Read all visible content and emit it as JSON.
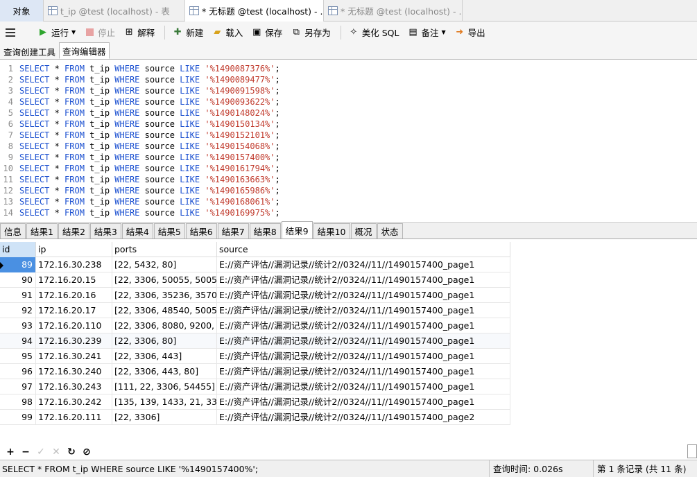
{
  "window_tabs": [
    {
      "label": "对象"
    },
    {
      "label": "t_ip @test (localhost) - 表"
    },
    {
      "label": "* 无标题 @test (localhost) - ..."
    },
    {
      "label": "* 无标题 @test (localhost) - ..."
    }
  ],
  "toolbar": {
    "run": "运行",
    "stop": "停止",
    "explain": "解释",
    "new": "新建",
    "load": "载入",
    "save": "保存",
    "save_as": "另存为",
    "beautify": "美化 SQL",
    "comment": "备注",
    "export": "导出"
  },
  "sub_tabs": [
    "查询创建工具",
    "查询编辑器"
  ],
  "editor": {
    "keyword_color": "#1a4fd0",
    "string_color": "#c0392b",
    "lines": [
      {
        "n": "1",
        "code": "SELECT * FROM t_ip WHERE source LIKE",
        "str": "'%1490087376%'"
      },
      {
        "n": "2",
        "code": "SELECT * FROM t_ip WHERE source LIKE",
        "str": "'%1490089477%'"
      },
      {
        "n": "3",
        "code": "SELECT * FROM t_ip WHERE source LIKE",
        "str": "'%1490091598%'"
      },
      {
        "n": "4",
        "code": "SELECT * FROM t_ip WHERE source LIKE",
        "str": "'%1490093622%'"
      },
      {
        "n": "5",
        "code": "SELECT * FROM t_ip WHERE source LIKE",
        "str": "'%1490148024%'"
      },
      {
        "n": "6",
        "code": "SELECT * FROM t_ip WHERE source LIKE",
        "str": "'%1490150134%'"
      },
      {
        "n": "7",
        "code": "SELECT * FROM t_ip WHERE source LIKE",
        "str": "'%1490152101%'"
      },
      {
        "n": "8",
        "code": "SELECT * FROM t_ip WHERE source LIKE",
        "str": "'%1490154068%'"
      },
      {
        "n": "9",
        "code": "SELECT * FROM t_ip WHERE source LIKE",
        "str": "'%1490157400%'"
      },
      {
        "n": "10",
        "code": "SELECT * FROM t_ip WHERE source LIKE",
        "str": "'%1490161794%'"
      },
      {
        "n": "11",
        "code": "SELECT * FROM t_ip WHERE source LIKE",
        "str": "'%1490163663%'"
      },
      {
        "n": "12",
        "code": "SELECT * FROM t_ip WHERE source LIKE",
        "str": "'%1490165986%'"
      },
      {
        "n": "13",
        "code": "SELECT * FROM t_ip WHERE source LIKE",
        "str": "'%1490168061%'"
      },
      {
        "n": "14",
        "code": "SELECT * FROM t_ip WHERE source LIKE",
        "str": "'%1490169975%'"
      }
    ]
  },
  "result_tabs": [
    "信息",
    "结果1",
    "结果2",
    "结果3",
    "结果4",
    "结果5",
    "结果6",
    "结果7",
    "结果8",
    "结果9",
    "结果10",
    "概况",
    "状态"
  ],
  "active_result_tab": "结果9",
  "grid": {
    "columns": [
      "id",
      "ip",
      "ports",
      "source"
    ],
    "rows": [
      [
        "89",
        "172.16.30.238",
        "[22, 5432, 80]",
        "E://资产评估//漏洞记录//统计2//0324//11//1490157400_page1"
      ],
      [
        "90",
        "172.16.20.15",
        "[22, 3306, 50055, 50058, 8",
        "E://资产评估//漏洞记录//统计2//0324//11//1490157400_page1"
      ],
      [
        "91",
        "172.16.20.16",
        "[22, 3306, 35236, 35704, 5",
        "E://资产评估//漏洞记录//统计2//0324//11//1490157400_page1"
      ],
      [
        "92",
        "172.16.20.17",
        "[22, 3306, 48540, 50055, 5",
        "E://资产评估//漏洞记录//统计2//0324//11//1490157400_page1"
      ],
      [
        "93",
        "172.16.20.110",
        "[22, 3306, 8080, 9200, 930",
        "E://资产评估//漏洞记录//统计2//0324//11//1490157400_page1"
      ],
      [
        "94",
        "172.16.30.239",
        "[22, 3306, 80]",
        "E://资产评估//漏洞记录//统计2//0324//11//1490157400_page1"
      ],
      [
        "95",
        "172.16.30.241",
        "[22, 3306, 443]",
        "E://资产评估//漏洞记录//统计2//0324//11//1490157400_page1"
      ],
      [
        "96",
        "172.16.30.240",
        "[22, 3306, 443, 80]",
        "E://资产评估//漏洞记录//统计2//0324//11//1490157400_page1"
      ],
      [
        "97",
        "172.16.30.243",
        "[111, 22, 3306, 54455]",
        "E://资产评估//漏洞记录//统计2//0324//11//1490157400_page1"
      ],
      [
        "98",
        "172.16.30.242",
        "[135, 139, 1433, 21, 3389, 5",
        "E://资产评估//漏洞记录//统计2//0324//11//1490157400_page1"
      ],
      [
        "99",
        "172.16.20.111",
        "[22, 3306]",
        "E://资产评估//漏洞记录//统计2//0324//11//1490157400_page2"
      ]
    ]
  },
  "status": {
    "sql": "SELECT * FROM t_ip WHERE source LIKE '%1490157400%';",
    "time": "查询时间: 0.026s",
    "records": "第 1 条记录 (共 11 条)"
  }
}
